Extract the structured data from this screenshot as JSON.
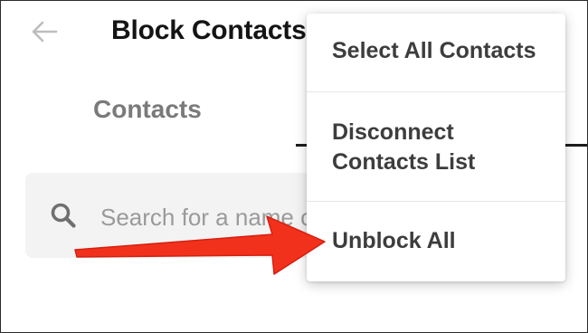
{
  "header": {
    "back_icon": "arrow-left-icon",
    "title": "Block Contacts"
  },
  "tabs": [
    {
      "label": "Contacts"
    }
  ],
  "search": {
    "icon": "search-icon",
    "placeholder": "Search for a name or number"
  },
  "menu": {
    "items": [
      {
        "label": "Select All Contacts"
      },
      {
        "label": "Disconnect\nContacts List"
      },
      {
        "label": "Unblock All"
      }
    ]
  },
  "colors": {
    "annotation_arrow": "#f2311d",
    "title_text": "#141414",
    "menu_text": "#3d3d3d",
    "muted_text": "#7a7a7a",
    "search_bg": "#f3f3f3"
  }
}
